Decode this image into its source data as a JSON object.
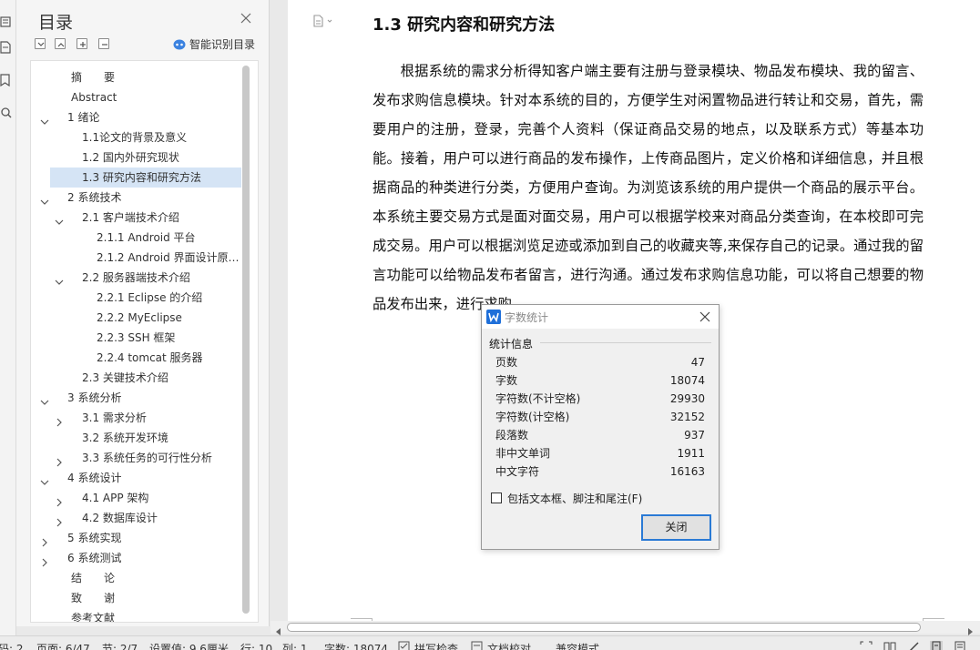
{
  "toc": {
    "title": "目录",
    "smart_label": "智能识别目录",
    "items": [
      {
        "label": "摘　　要",
        "level": 0,
        "chevron": "none"
      },
      {
        "label": "Abstract",
        "level": 0,
        "chevron": "none"
      },
      {
        "label": "1 绪论",
        "level": 0,
        "chevron": "down"
      },
      {
        "label": "1.1论文的背景及意义",
        "level": 1,
        "chevron": "none"
      },
      {
        "label": "1.2 国内外研究现状",
        "level": 1,
        "chevron": "none"
      },
      {
        "label": "1.3  研究内容和研究方法",
        "level": 1,
        "chevron": "none",
        "selected": true
      },
      {
        "label": "2 系统技术",
        "level": 0,
        "chevron": "down"
      },
      {
        "label": "2.1 客户端技术介绍",
        "level": 1,
        "chevron": "down"
      },
      {
        "label": "2.1.1 Android  平台",
        "level": 2,
        "chevron": "none"
      },
      {
        "label": "2.1.2 Android  界面设计原…",
        "level": 2,
        "chevron": "none"
      },
      {
        "label": "2.2 服务器端技术介绍",
        "level": 1,
        "chevron": "down"
      },
      {
        "label": "2.2.1 Eclipse  的介绍",
        "level": 2,
        "chevron": "none"
      },
      {
        "label": "2.2.2 MyEclipse",
        "level": 2,
        "chevron": "none"
      },
      {
        "label": "2.2.3 SSH  框架",
        "level": 2,
        "chevron": "none"
      },
      {
        "label": "2.2.4 tomcat  服务器",
        "level": 2,
        "chevron": "none"
      },
      {
        "label": "2.3  关键技术介绍",
        "level": 1,
        "chevron": "none"
      },
      {
        "label": "3 系统分析",
        "level": 0,
        "chevron": "down"
      },
      {
        "label": "3.1 需求分析",
        "level": 1,
        "chevron": "right"
      },
      {
        "label": "3.2    系统开发环境",
        "level": 1,
        "chevron": "none"
      },
      {
        "label": "3.3    系统任务的可行性分析",
        "level": 1,
        "chevron": "right"
      },
      {
        "label": "4 系统设计",
        "level": 0,
        "chevron": "down"
      },
      {
        "label": "4.1    APP 架构",
        "level": 1,
        "chevron": "right"
      },
      {
        "label": "4.2    数据库设计",
        "level": 1,
        "chevron": "right"
      },
      {
        "label": "5 系统实现",
        "level": 0,
        "chevron": "right"
      },
      {
        "label": "6 系统测试",
        "level": 0,
        "chevron": "right"
      },
      {
        "label": "结　　论",
        "level": 0,
        "chevron": "none"
      },
      {
        "label": "致　　谢",
        "level": 0,
        "chevron": "none"
      },
      {
        "label": "参考文献",
        "level": 0,
        "chevron": "none"
      }
    ]
  },
  "document": {
    "heading": "1.3  研究内容和研究方法",
    "paragraph": "根据系统的需求分析得知客户端主要有注册与登录模块、物品发布模块、我的留言、发布求购信息模块。针对本系统的目的，方便学生对闲置物品进行转让和交易，首先，需要用户的注册，登录，完善个人资料（保证商品交易的地点，以及联系方式）等基本功能。接着，用户可以进行商品的发布操作，上传商品图片，定义价格和详细信息，并且根据商品的种类进行分类，方便用户查询。为浏览该系统的用户提供一个商品的展示平台。本系统主要交易方式是面对面交易，用户可以根据学校来对商品分类查询，在本校即可完成交易。用户可以根据浏览足迹或添加到自己的收藏夹等,来保存自己的记录。通过我的留言功能可以给物品发布者留言，进行沟通。通过发布求购信息功能，可以将自己想要的物品发布出来，进行求购。"
  },
  "dialog": {
    "title": "字数统计",
    "section": "统计信息",
    "stats": [
      {
        "label": "页数",
        "value": "47"
      },
      {
        "label": "字数",
        "value": "18074"
      },
      {
        "label": "字符数(不计空格)",
        "value": "29930"
      },
      {
        "label": "字符数(计空格)",
        "value": "32152"
      },
      {
        "label": "段落数",
        "value": "937"
      },
      {
        "label": "非中文单词",
        "value": "1911"
      },
      {
        "label": "中文字符",
        "value": "16163"
      }
    ],
    "checkbox_label": "包括文本框、脚注和尾注(F)",
    "close_button": "关闭"
  },
  "statusbar": {
    "section_left": "码: 2",
    "page": "页面: 6/47",
    "section": "节: 2/7",
    "setting": "设置值: 9.6厘米",
    "row": "行: 10",
    "col": "列: 1",
    "wordcount": "字数: 18074",
    "spellcheck": "拼写检查",
    "doc_check": "文档校对",
    "compat": "兼容模式"
  },
  "colors": {
    "accent": "#2a7ad5",
    "selected_row": "#d5e4f5",
    "app_icon": "#1e6fd9"
  }
}
